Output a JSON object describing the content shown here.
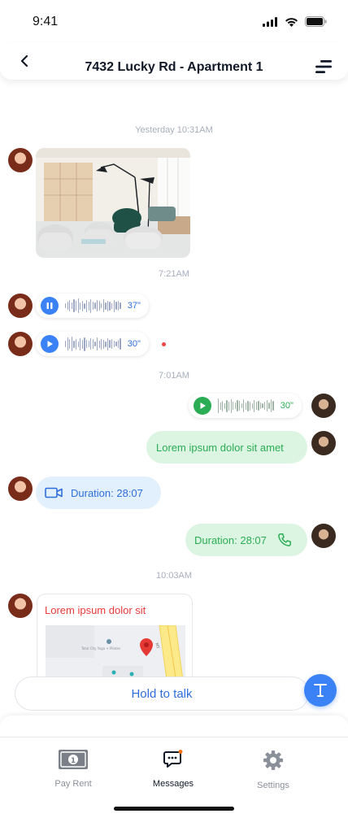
{
  "status_bar": {
    "time": "9:41"
  },
  "header": {
    "title": "7432 Lucky Rd - Apartment 1"
  },
  "colors": {
    "accent_blue": "#3b82f6",
    "green": "#2bad55",
    "red": "#ea3b3b",
    "timestamp_gray": "#a8aebc"
  },
  "chat": {
    "timestamps": [
      "Yesterday 10:31AM",
      "7:21AM",
      "7:01AM",
      "10:03AM"
    ],
    "voice_messages": [
      {
        "state": "playing",
        "duration": "37\""
      },
      {
        "state": "paused",
        "duration": "30\"",
        "unread": true
      },
      {
        "state": "paused",
        "duration": "30\"",
        "sent": true
      }
    ],
    "text_message": "Lorem ipsum dolor sit amet",
    "video_call": {
      "label": "Duration: 28:07",
      "icon": "video-camera-icon"
    },
    "voice_call": {
      "label": "Duration: 28:07",
      "icon": "phone-icon"
    },
    "location": {
      "title": "Lorem ipsum dolor sit",
      "map_label": "Total City Yoga + Pilates"
    }
  },
  "composer": {
    "hold_to_talk": "Hold to talk",
    "text_button": "T"
  },
  "tabs": [
    {
      "label": "Pay Rent",
      "icon": "banknote-icon",
      "active": false
    },
    {
      "label": "Messages",
      "icon": "chat-icon",
      "active": true
    },
    {
      "label": "Settings",
      "icon": "gear-icon",
      "active": false
    }
  ]
}
